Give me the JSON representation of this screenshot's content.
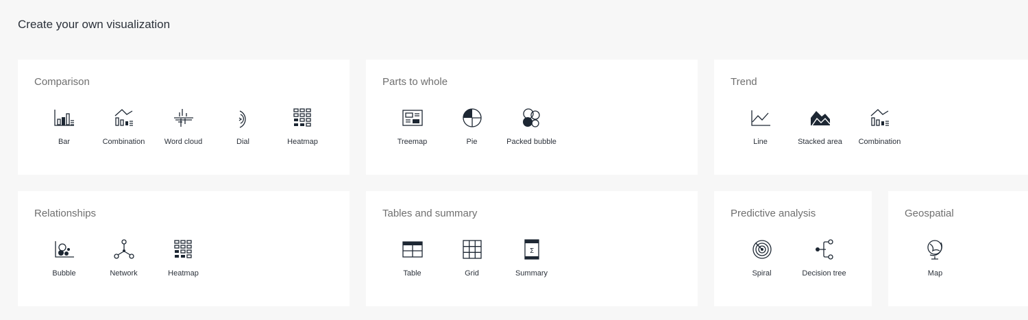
{
  "page_title": "Create your own visualization",
  "panels": {
    "comparison": {
      "title": "Comparison",
      "items": [
        {
          "label": "Bar",
          "icon": "bar-chart-icon"
        },
        {
          "label": "Combination",
          "icon": "combination-chart-icon"
        },
        {
          "label": "Word cloud",
          "icon": "word-cloud-icon"
        },
        {
          "label": "Dial",
          "icon": "dial-icon"
        },
        {
          "label": "Heatmap",
          "icon": "heatmap-icon"
        }
      ]
    },
    "parts_to_whole": {
      "title": "Parts to whole",
      "items": [
        {
          "label": "Treemap",
          "icon": "treemap-icon"
        },
        {
          "label": "Pie",
          "icon": "pie-chart-icon"
        },
        {
          "label": "Packed bubble",
          "icon": "packed-bubble-icon"
        }
      ]
    },
    "trend": {
      "title": "Trend",
      "items": [
        {
          "label": "Line",
          "icon": "line-chart-icon"
        },
        {
          "label": "Stacked area",
          "icon": "stacked-area-icon"
        },
        {
          "label": "Combination",
          "icon": "combination-chart-icon"
        }
      ]
    },
    "relationships": {
      "title": "Relationships",
      "items": [
        {
          "label": "Bubble",
          "icon": "bubble-chart-icon"
        },
        {
          "label": "Network",
          "icon": "network-icon"
        },
        {
          "label": "Heatmap",
          "icon": "heatmap-icon"
        }
      ]
    },
    "tables_summary": {
      "title": "Tables and summary",
      "items": [
        {
          "label": "Table",
          "icon": "table-icon"
        },
        {
          "label": "Grid",
          "icon": "grid-icon"
        },
        {
          "label": "Summary",
          "icon": "summary-icon"
        }
      ]
    },
    "predictive": {
      "title": "Predictive analysis",
      "items": [
        {
          "label": "Spiral",
          "icon": "spiral-icon"
        },
        {
          "label": "Decision tree",
          "icon": "decision-tree-icon"
        }
      ]
    },
    "geospatial": {
      "title": "Geospatial",
      "items": [
        {
          "label": "Map",
          "icon": "globe-icon"
        }
      ]
    }
  }
}
